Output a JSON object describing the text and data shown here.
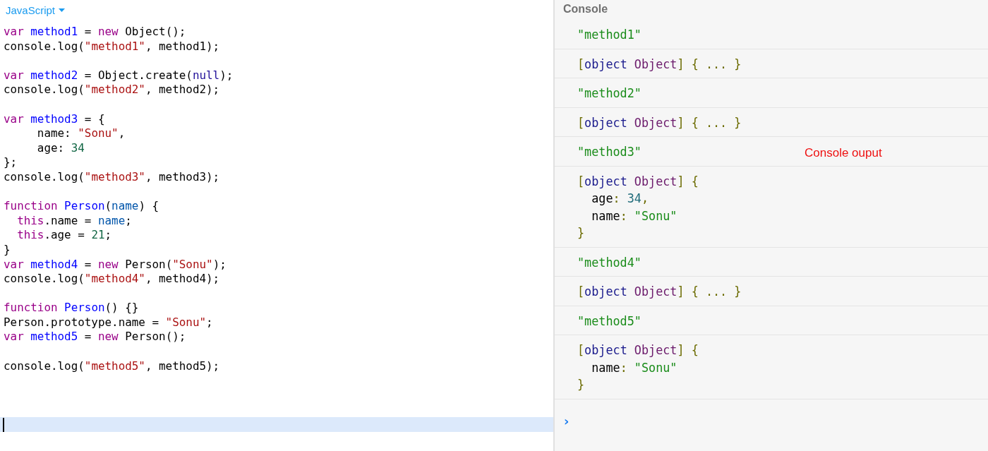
{
  "editor": {
    "language": "JavaScript",
    "lines": [
      {
        "kind": "code",
        "active": false,
        "tokens": [
          {
            "kind": "kw",
            "text": "var "
          },
          {
            "kind": "def",
            "text": "method1"
          },
          {
            "kind": "p",
            "text": " = "
          },
          {
            "kind": "kw",
            "text": "new "
          },
          {
            "kind": "p",
            "text": "Object();"
          }
        ]
      },
      {
        "kind": "code",
        "active": false,
        "tokens": [
          {
            "kind": "p",
            "text": "console.log("
          },
          {
            "kind": "str",
            "text": "\"method1\""
          },
          {
            "kind": "p",
            "text": ", method1);"
          }
        ]
      },
      {
        "kind": "blank",
        "active": false
      },
      {
        "kind": "code",
        "active": false,
        "tokens": [
          {
            "kind": "kw",
            "text": "var "
          },
          {
            "kind": "def",
            "text": "method2"
          },
          {
            "kind": "p",
            "text": " = Object.create("
          },
          {
            "kind": "atom",
            "text": "null"
          },
          {
            "kind": "p",
            "text": ");"
          }
        ]
      },
      {
        "kind": "code",
        "active": false,
        "tokens": [
          {
            "kind": "p",
            "text": "console.log("
          },
          {
            "kind": "str",
            "text": "\"method2\""
          },
          {
            "kind": "p",
            "text": ", method2);"
          }
        ]
      },
      {
        "kind": "blank",
        "active": false
      },
      {
        "kind": "code",
        "active": false,
        "tokens": [
          {
            "kind": "kw",
            "text": "var "
          },
          {
            "kind": "def",
            "text": "method3"
          },
          {
            "kind": "p",
            "text": " = {"
          }
        ]
      },
      {
        "kind": "code",
        "active": false,
        "tokens": [
          {
            "kind": "p",
            "text": "     name: "
          },
          {
            "kind": "str",
            "text": "\"Sonu\""
          },
          {
            "kind": "p",
            "text": ","
          }
        ]
      },
      {
        "kind": "code",
        "active": false,
        "tokens": [
          {
            "kind": "p",
            "text": "     age: "
          },
          {
            "kind": "num",
            "text": "34"
          }
        ]
      },
      {
        "kind": "code",
        "active": false,
        "tokens": [
          {
            "kind": "p",
            "text": "};"
          }
        ]
      },
      {
        "kind": "code",
        "active": false,
        "tokens": [
          {
            "kind": "p",
            "text": "console.log("
          },
          {
            "kind": "str",
            "text": "\"method3\""
          },
          {
            "kind": "p",
            "text": ", method3);"
          }
        ]
      },
      {
        "kind": "blank",
        "active": false
      },
      {
        "kind": "code",
        "active": false,
        "tokens": [
          {
            "kind": "kw",
            "text": "function "
          },
          {
            "kind": "def",
            "text": "Person"
          },
          {
            "kind": "p",
            "text": "("
          },
          {
            "kind": "var2",
            "text": "name"
          },
          {
            "kind": "p",
            "text": ") {"
          }
        ]
      },
      {
        "kind": "code",
        "active": false,
        "tokens": [
          {
            "kind": "kw",
            "text": "  this"
          },
          {
            "kind": "p",
            "text": ".name = "
          },
          {
            "kind": "var2",
            "text": "name"
          },
          {
            "kind": "p",
            "text": ";"
          }
        ]
      },
      {
        "kind": "code",
        "active": false,
        "tokens": [
          {
            "kind": "kw",
            "text": "  this"
          },
          {
            "kind": "p",
            "text": ".age = "
          },
          {
            "kind": "num",
            "text": "21"
          },
          {
            "kind": "p",
            "text": ";"
          }
        ]
      },
      {
        "kind": "code",
        "active": false,
        "tokens": [
          {
            "kind": "p",
            "text": "}"
          }
        ]
      },
      {
        "kind": "code",
        "active": false,
        "tokens": [
          {
            "kind": "kw",
            "text": "var "
          },
          {
            "kind": "def",
            "text": "method4"
          },
          {
            "kind": "p",
            "text": " = "
          },
          {
            "kind": "kw",
            "text": "new "
          },
          {
            "kind": "p",
            "text": "Person("
          },
          {
            "kind": "str",
            "text": "\"Sonu\""
          },
          {
            "kind": "p",
            "text": ");"
          }
        ]
      },
      {
        "kind": "code",
        "active": false,
        "tokens": [
          {
            "kind": "p",
            "text": "console.log("
          },
          {
            "kind": "str",
            "text": "\"method4\""
          },
          {
            "kind": "p",
            "text": ", method4);"
          }
        ]
      },
      {
        "kind": "blank",
        "active": false
      },
      {
        "kind": "code",
        "active": false,
        "tokens": [
          {
            "kind": "kw",
            "text": "function "
          },
          {
            "kind": "def",
            "text": "Person"
          },
          {
            "kind": "p",
            "text": "() {}"
          }
        ]
      },
      {
        "kind": "code",
        "active": false,
        "tokens": [
          {
            "kind": "p",
            "text": "Person.prototype.name = "
          },
          {
            "kind": "str",
            "text": "\"Sonu\""
          },
          {
            "kind": "p",
            "text": ";"
          }
        ]
      },
      {
        "kind": "code",
        "active": false,
        "tokens": [
          {
            "kind": "kw",
            "text": "var "
          },
          {
            "kind": "def",
            "text": "method5"
          },
          {
            "kind": "p",
            "text": " = "
          },
          {
            "kind": "kw",
            "text": "new "
          },
          {
            "kind": "p",
            "text": "Person();"
          }
        ]
      },
      {
        "kind": "blank",
        "active": false
      },
      {
        "kind": "code",
        "active": false,
        "tokens": [
          {
            "kind": "p",
            "text": "console.log("
          },
          {
            "kind": "str",
            "text": "\"method5\""
          },
          {
            "kind": "p",
            "text": ", method5);"
          }
        ]
      },
      {
        "kind": "blank",
        "active": false
      },
      {
        "kind": "blank",
        "active": false
      },
      {
        "kind": "blank",
        "active": false
      },
      {
        "kind": "blank",
        "active": true
      }
    ]
  },
  "console": {
    "title": "Console",
    "annotation": "Console ouput",
    "prompt": "›",
    "entries": [
      {
        "lines": [
          {
            "tokens": [
              {
                "kind": "str",
                "text": "\"method1\""
              }
            ]
          }
        ]
      },
      {
        "lines": [
          {
            "tokens": [
              {
                "kind": "br",
                "text": "["
              },
              {
                "kind": "obj",
                "text": "object "
              },
              {
                "kind": "cls",
                "text": "Object"
              },
              {
                "kind": "br",
                "text": "] { ... }"
              }
            ]
          }
        ]
      },
      {
        "lines": [
          {
            "tokens": [
              {
                "kind": "str",
                "text": "\"method2\""
              }
            ]
          }
        ]
      },
      {
        "lines": [
          {
            "tokens": [
              {
                "kind": "br",
                "text": "["
              },
              {
                "kind": "obj",
                "text": "object "
              },
              {
                "kind": "cls",
                "text": "Object"
              },
              {
                "kind": "br",
                "text": "] { ... }"
              }
            ]
          }
        ]
      },
      {
        "lines": [
          {
            "tokens": [
              {
                "kind": "str",
                "text": "\"method3\""
              }
            ]
          }
        ]
      },
      {
        "lines": [
          {
            "tokens": [
              {
                "kind": "br",
                "text": "["
              },
              {
                "kind": "obj",
                "text": "object "
              },
              {
                "kind": "cls",
                "text": "Object"
              },
              {
                "kind": "br",
                "text": "] {"
              }
            ]
          },
          {
            "tokens": [
              {
                "kind": "p",
                "text": "  age"
              },
              {
                "kind": "br",
                "text": ": "
              },
              {
                "kind": "num",
                "text": "34"
              },
              {
                "kind": "br",
                "text": ","
              }
            ]
          },
          {
            "tokens": [
              {
                "kind": "p",
                "text": "  name"
              },
              {
                "kind": "br",
                "text": ": "
              },
              {
                "kind": "str",
                "text": "\"Sonu\""
              }
            ]
          },
          {
            "tokens": [
              {
                "kind": "br",
                "text": "}"
              }
            ]
          }
        ]
      },
      {
        "lines": [
          {
            "tokens": [
              {
                "kind": "str",
                "text": "\"method4\""
              }
            ]
          }
        ]
      },
      {
        "lines": [
          {
            "tokens": [
              {
                "kind": "br",
                "text": "["
              },
              {
                "kind": "obj",
                "text": "object "
              },
              {
                "kind": "cls",
                "text": "Object"
              },
              {
                "kind": "br",
                "text": "] { ... }"
              }
            ]
          }
        ]
      },
      {
        "lines": [
          {
            "tokens": [
              {
                "kind": "str",
                "text": "\"method5\""
              }
            ]
          }
        ]
      },
      {
        "lines": [
          {
            "tokens": [
              {
                "kind": "br",
                "text": "["
              },
              {
                "kind": "obj",
                "text": "object "
              },
              {
                "kind": "cls",
                "text": "Object"
              },
              {
                "kind": "br",
                "text": "] {"
              }
            ]
          },
          {
            "tokens": [
              {
                "kind": "p",
                "text": "  name"
              },
              {
                "kind": "br",
                "text": ": "
              },
              {
                "kind": "str",
                "text": "\"Sonu\""
              }
            ]
          },
          {
            "tokens": [
              {
                "kind": "br",
                "text": "}"
              }
            ]
          }
        ]
      }
    ]
  }
}
